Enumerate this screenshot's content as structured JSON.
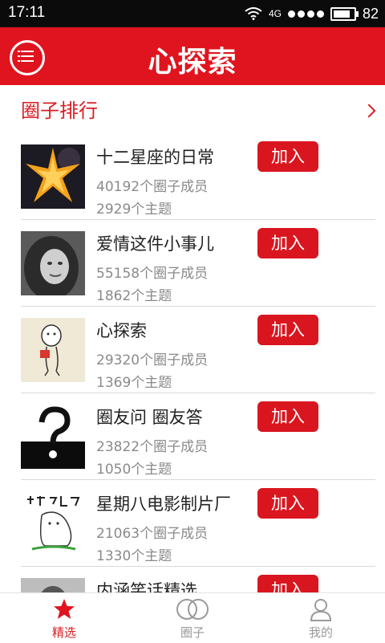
{
  "status_bar": {
    "time": "17:11",
    "network": "4G",
    "battery": "82"
  },
  "header": {
    "title": "心探索",
    "menu_icon": "menu-list-icon"
  },
  "section": {
    "title": "圈子排行"
  },
  "join_label": "加入",
  "circles": [
    {
      "name": "十二星座的日常",
      "members": "40192个圈子成员",
      "topics": "2929个主题"
    },
    {
      "name": "爱情这件小事儿",
      "members": "55158个圈子成员",
      "topics": "1862个主题"
    },
    {
      "name": "心探索",
      "members": "29320个圈子成员",
      "topics": "1369个主题"
    },
    {
      "name": "圈友问 圈友答",
      "members": "23822个圈子成员",
      "topics": "1050个主题"
    },
    {
      "name": "星期八电影制片厂",
      "members": "21063个圈子成员",
      "topics": "1330个主题"
    },
    {
      "name": "内涵笑话精选",
      "members": "",
      "topics": ""
    }
  ],
  "tabs": [
    {
      "label": "精选",
      "icon": "star-icon",
      "active": true
    },
    {
      "label": "圈子",
      "icon": "circles-icon",
      "active": false
    },
    {
      "label": "我的",
      "icon": "user-icon",
      "active": false
    }
  ],
  "colors": {
    "brand": "#e0141e",
    "button": "#d9161f",
    "muted_text": "#8a8a8a",
    "inactive_tab": "#9a9a9a"
  }
}
